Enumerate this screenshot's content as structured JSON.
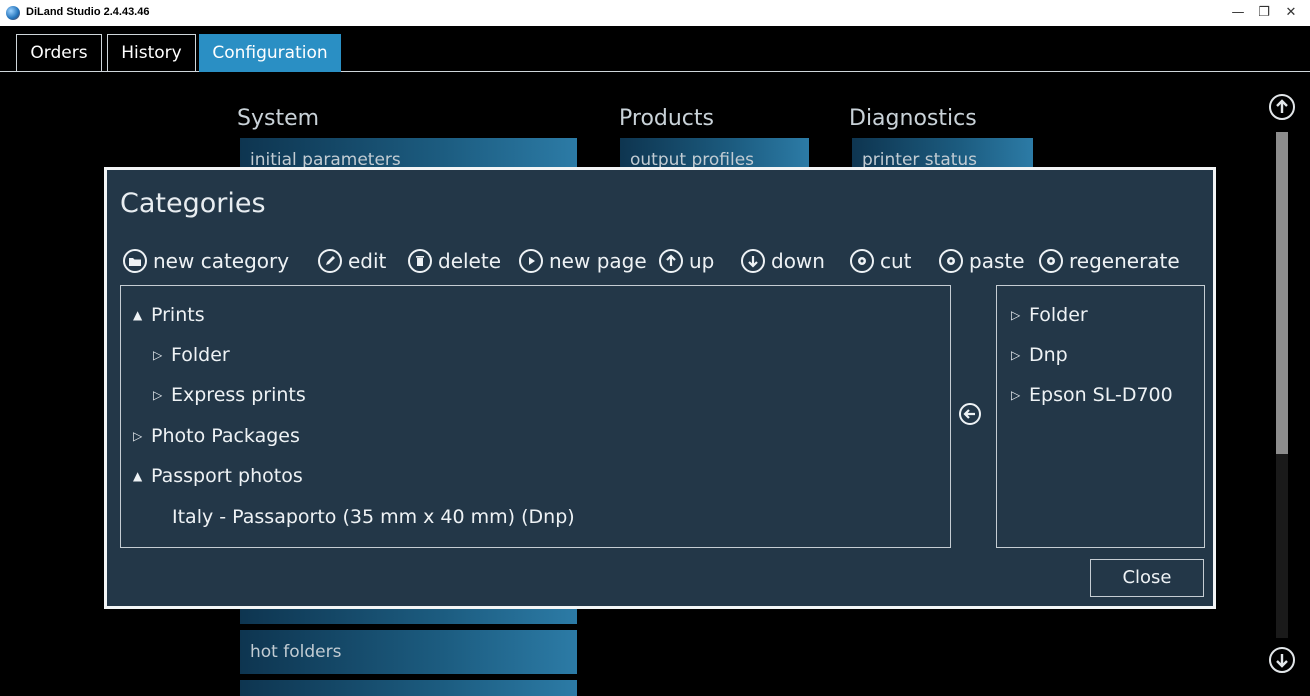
{
  "window": {
    "title": "DiLand Studio 2.4.43.46",
    "minimize": "—",
    "restore": "❐",
    "close": "✕"
  },
  "tabs": [
    {
      "label": "Orders"
    },
    {
      "label": "History"
    },
    {
      "label": "Configuration",
      "active": true
    }
  ],
  "config": {
    "system": {
      "title": "System",
      "buttons": [
        "initial parameters",
        "hot folders"
      ]
    },
    "products": {
      "title": "Products",
      "buttons": [
        "output profiles"
      ]
    },
    "diagnostics": {
      "title": "Diagnostics",
      "buttons": [
        "printer status"
      ]
    }
  },
  "dialog": {
    "title": "Categories",
    "toolbar": [
      {
        "label": "new category",
        "icon": "folder-icon"
      },
      {
        "label": "edit",
        "icon": "pencil-icon"
      },
      {
        "label": "delete",
        "icon": "trash-icon"
      },
      {
        "label": "new page",
        "icon": "play-icon"
      },
      {
        "label": "up",
        "icon": "arrow-up-icon"
      },
      {
        "label": "down",
        "icon": "arrow-down-icon"
      },
      {
        "label": "cut",
        "icon": "gear-icon"
      },
      {
        "label": "paste",
        "icon": "gear-icon"
      },
      {
        "label": "regenerate",
        "icon": "gear-icon"
      }
    ],
    "tree": [
      {
        "label": "Prints",
        "expander": "▲",
        "level": 0
      },
      {
        "label": "Folder",
        "expander": "▷",
        "level": 1
      },
      {
        "label": "Express prints",
        "expander": "▷",
        "level": 1
      },
      {
        "label": "Photo Packages",
        "expander": "▷",
        "level": 0
      },
      {
        "label": "Passport photos",
        "expander": "▲",
        "level": 0
      },
      {
        "label": "Italy - Passaporto (35 mm x 40 mm) (Dnp)",
        "expander": "",
        "level": 2
      }
    ],
    "printers": [
      {
        "label": "Folder",
        "expander": "▷"
      },
      {
        "label": "Dnp",
        "expander": "▷"
      },
      {
        "label": "Epson SL-D700",
        "expander": "▷"
      }
    ],
    "close_label": "Close"
  },
  "scrollbar": {
    "position": 0
  }
}
